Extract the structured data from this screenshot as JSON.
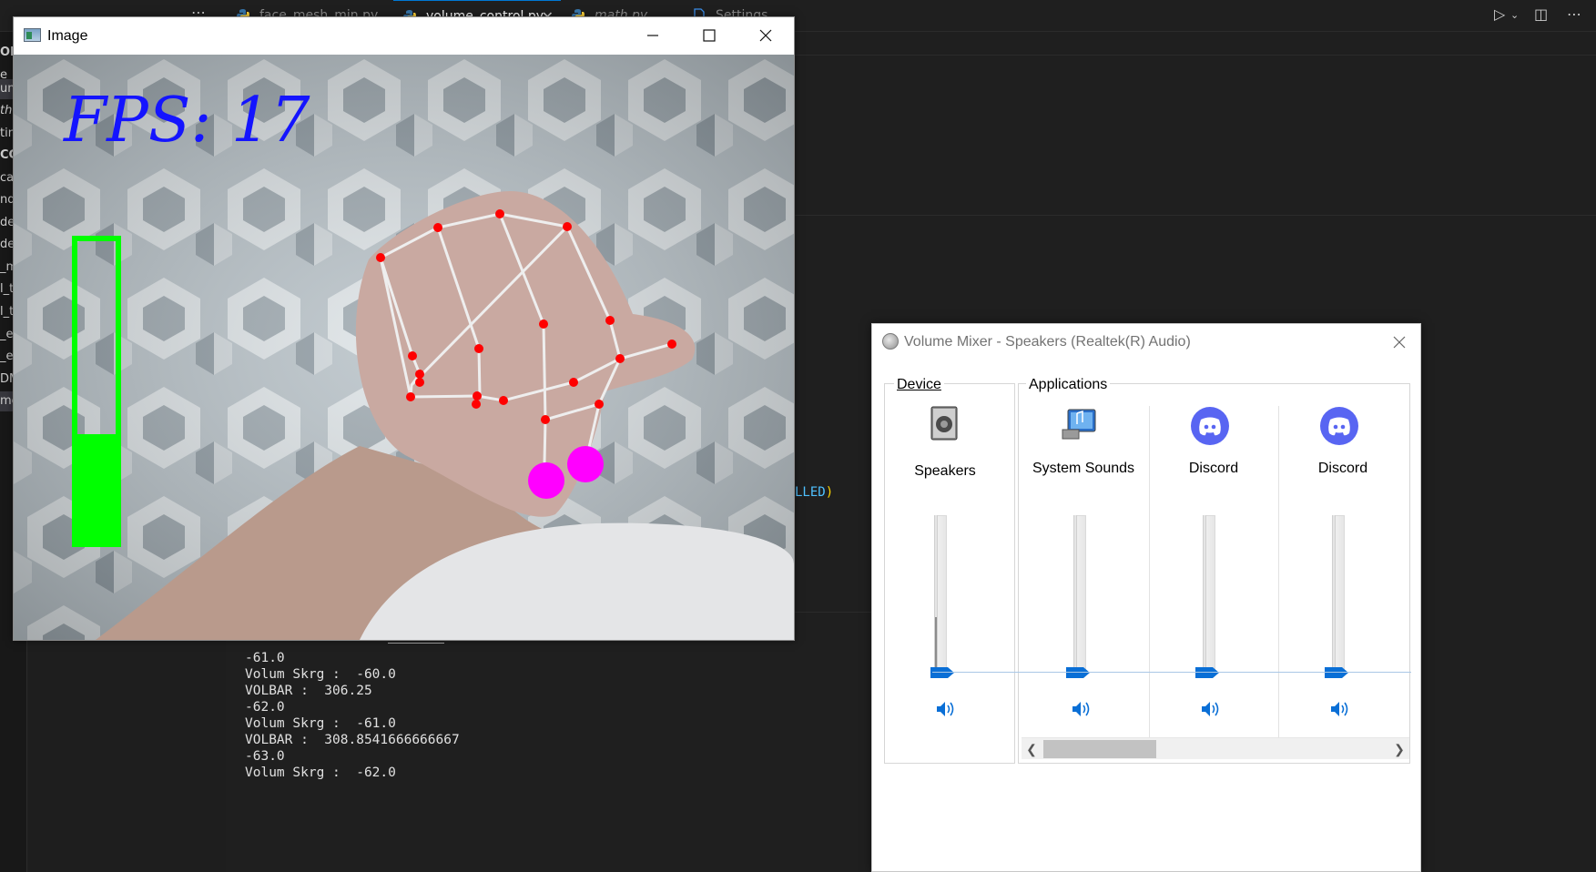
{
  "vscode": {
    "tabs": [
      {
        "label": "face_mesh_min.py",
        "italic": false,
        "active": false
      },
      {
        "label": "volume_control.py",
        "italic": false,
        "active": true
      },
      {
        "label": "math.py",
        "italic": true,
        "active": false
      },
      {
        "label": "Settings",
        "italic": false,
        "active": false
      }
    ],
    "explorer_fragments": [
      "ORS",
      "e_n",
      "um",
      "th.",
      "tin",
      "CC",
      "cad",
      "nd",
      "de",
      "de",
      "_m",
      "l_t",
      "l_t",
      "_e",
      "_e",
      "DM",
      "me"
    ],
    "code_fragment": "LLED",
    "code_fragment_paren": ")",
    "terminal_lines": [
      "-61.0",
      "Volum Skrg :  -60.0",
      "VOLBAR :  306.25",
      "-62.0",
      "Volum Skrg :  -61.0",
      "VOLBAR :  308.8541666666667",
      "-63.0",
      "Volum Skrg :  -62.0"
    ]
  },
  "image_window": {
    "title": "Image",
    "fps_label": "FPS: 17",
    "volume_bar_level": 0.36,
    "colors": {
      "fps": "#1414ff",
      "bar": "#00ff00",
      "landmark": "#ff0000",
      "connection": "#eeeeee",
      "fingertip": "#ff00ff"
    }
  },
  "volume_mixer": {
    "title": "Volume Mixer - Speakers (Realtek(R) Audio)",
    "device_group_label": "Device",
    "applications_group_label": "Applications",
    "device": {
      "name": "Speakers",
      "level": 0.0
    },
    "applications": [
      {
        "name": "System Sounds",
        "icon": "system-sounds-icon",
        "level": 0.0
      },
      {
        "name": "Discord",
        "icon": "discord-icon",
        "level": 0.0
      },
      {
        "name": "Discord",
        "icon": "discord-icon",
        "level": 0.0
      }
    ],
    "accent_color": "#0a6fd6"
  }
}
